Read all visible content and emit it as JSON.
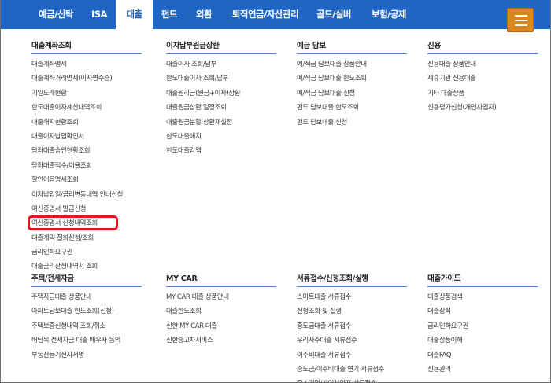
{
  "nav": {
    "tabs": [
      {
        "label": "예금/신탁",
        "active": false
      },
      {
        "label": "ISA",
        "active": false
      },
      {
        "label": "대출",
        "active": true
      },
      {
        "label": "펀드",
        "active": false
      },
      {
        "label": "외환",
        "active": false
      },
      {
        "label": "퇴직연금/자산관리",
        "active": false
      },
      {
        "label": "골드/실버",
        "active": false
      },
      {
        "label": "보험/공제",
        "active": false
      }
    ],
    "menu_icon": "hamburger-menu-icon"
  },
  "colors": {
    "nav_bg": "#1f66c4",
    "menu_button": "#d9861c",
    "highlight": "#e8161b",
    "section_line": "#4d86d0"
  },
  "sections": [
    {
      "title": "대출계좌조회",
      "items": [
        "대출계좌명세",
        "대출계좌거래명세(이자영수증)",
        "기일도래현황",
        "한도대출이자계산내역조회",
        "대출해지현황조회",
        "대출이자납입확인서",
        "당좌대출승인현황조회",
        "당좌대출적수/이율조회",
        "할인어음명세조회",
        "이자납입일/금리변동내역 안내신청",
        "여신증명서 발급신청",
        "여신증명서 신청내역조회",
        "대출계약 철회신청/조회",
        "금리인하요구권",
        "대출금리산정내역서 조회"
      ],
      "highlight_index": 11
    },
    {
      "title": "이자납부원금상환",
      "items": [
        "대출이자 조회/납부",
        "한도대출이자 조회/납부",
        "대출원리금(원금+이자)상환",
        "대출원금상환 일정조회",
        "대출원금분할 상환재설정",
        "한도대출해지",
        "한도대출감액"
      ]
    },
    {
      "title": "예금 담보",
      "items": [
        "예/적금 담보대출 상품안내",
        "예/적금 담보대출 한도조회",
        "예/적금 담보대출 신청",
        "펀드 담보대출 한도조회",
        "펀드 담보대출 신청"
      ]
    },
    {
      "title": "신용",
      "items": [
        "신용대출 상품안내",
        "제휴기관 신용대출",
        "기타 대출상품",
        "신용평가신청(개인사업자)"
      ]
    },
    {
      "title": "주택/전세자금",
      "items": [
        "주택자금대출 상품안내",
        "아파트담보대출 한도조회(신청)",
        "주택보증신청내역 조회/취소",
        "버팀목 전세자금 대출 배우자 동의",
        "부동산등기전자서명"
      ]
    },
    {
      "title": "MY CAR",
      "items": [
        "MY CAR 대출 상품안내",
        "대출한도조회",
        "신한 MY CAR 대출",
        "신한중고차서비스"
      ]
    },
    {
      "title": "서류접수/신청조회/실행",
      "items": [
        "스마트대출 서류접수",
        "신청조회 및 실행",
        "중도금대출 서류접수",
        "우리사주대출 서류접수",
        "이주비대출 서류접수",
        "중도금/이주비대출 연기 서류접수",
        "중소기업/개인사업자 서류접수"
      ]
    },
    {
      "title": "대출가이드",
      "items": [
        "대출상품검색",
        "대출상식",
        "금리인하요구권",
        "대출상품이해",
        "대출FAQ",
        "신용관리"
      ]
    }
  ]
}
